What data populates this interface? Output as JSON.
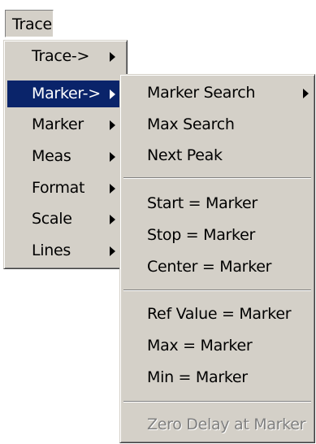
{
  "menubar": {
    "title": "Trace"
  },
  "trace_menu": {
    "items": [
      {
        "label": "Trace->",
        "has_submenu": true
      },
      {
        "label": "Marker->",
        "has_submenu": true,
        "selected": true
      },
      {
        "label": "Marker",
        "has_submenu": true
      },
      {
        "label": "Meas",
        "has_submenu": true
      },
      {
        "label": "Format",
        "has_submenu": true
      },
      {
        "label": "Scale",
        "has_submenu": true
      },
      {
        "label": "Lines",
        "has_submenu": true
      }
    ]
  },
  "marker_submenu": {
    "items": [
      {
        "label": "Marker Search",
        "has_submenu": true
      },
      {
        "label": "Max Search"
      },
      {
        "label": "Next Peak"
      },
      {
        "label": "Start = Marker"
      },
      {
        "label": "Stop = Marker"
      },
      {
        "label": "Center = Marker"
      },
      {
        "label": "Ref Value = Marker"
      },
      {
        "label": "Max = Marker"
      },
      {
        "label": "Min = Marker"
      },
      {
        "label": "Zero Delay at Marker",
        "disabled": true
      }
    ]
  },
  "colors": {
    "menu_background": "#d4d0c8",
    "highlight": "#0a246a",
    "highlight_text": "#ffffff",
    "disabled_text": "#808080"
  }
}
